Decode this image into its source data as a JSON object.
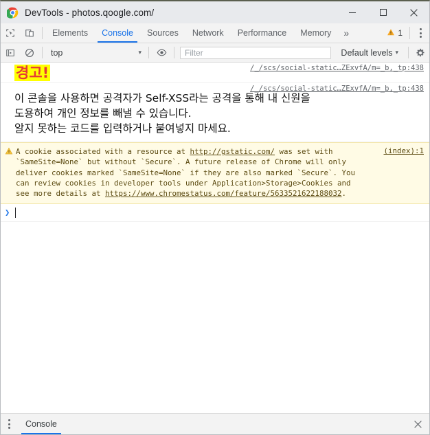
{
  "window": {
    "title": "DevTools - photos.qoogle.com/",
    "controls": {
      "minimize": "minimize-button",
      "maximize": "maximize-button",
      "close": "close-button"
    }
  },
  "tabstrip": {
    "inspect_icon": "inspect-element-icon",
    "device_icon": "device-toolbar-icon",
    "tabs": [
      {
        "label": "Elements",
        "active": false
      },
      {
        "label": "Console",
        "active": true
      },
      {
        "label": "Sources",
        "active": false
      },
      {
        "label": "Network",
        "active": false
      },
      {
        "label": "Performance",
        "active": false
      },
      {
        "label": "Memory",
        "active": false
      }
    ],
    "more_label": "»",
    "warning_count": "1",
    "warning_color": "#f5a623"
  },
  "filterbar": {
    "execute_icon": "execute-snippet-icon",
    "clear_icon": "clear-console-icon",
    "context": "top",
    "context_caret": "▾",
    "eye_icon": "live-expression-icon",
    "filter_placeholder": "Filter",
    "filter_value": "",
    "levels_label": "Default levels",
    "levels_caret": "▾",
    "settings_icon": "gear-icon"
  },
  "console": {
    "self_xss": {
      "title": "경고!",
      "title_color": "#e53935",
      "highlight_color": "#ffff00",
      "body": "이 콘솔을 사용하면 공격자가 Self-XSS라는 공격을 통해 내 신원을\n도용하여 개인 정보를 빼낼 수 있습니다.\n알지 못하는 코드를 입력하거나 붙여넣지 마세요.",
      "source_link_1": "/_/scs/social-static…ZExvfA/m=_b,_tp:438",
      "source_link_2": "/_/scs/social-static…ZExvfA/m=_b,_tp:438"
    },
    "cookie_warning": {
      "icon": "warning-triangle-icon",
      "source_link": "(index):1",
      "seg1": "A cookie associated with a resource at ",
      "link1": "http://gstatic.com/",
      "seg2": " was set with `SameSite=None` but without `Secure`. A future release of Chrome will only deliver cookies marked `SameSite=None` if they are also marked `Secure`. You can review cookies in developer tools under Application>Storage>Cookies and see more details at ",
      "link2": "https://www.chromestatus.com/feature/5633521622188032",
      "seg3": "."
    },
    "prompt": {
      "caret": "❯",
      "value": ""
    }
  },
  "drawer": {
    "tabs": [
      {
        "label": "Console",
        "active": true
      }
    ],
    "close_icon": "close-icon"
  }
}
